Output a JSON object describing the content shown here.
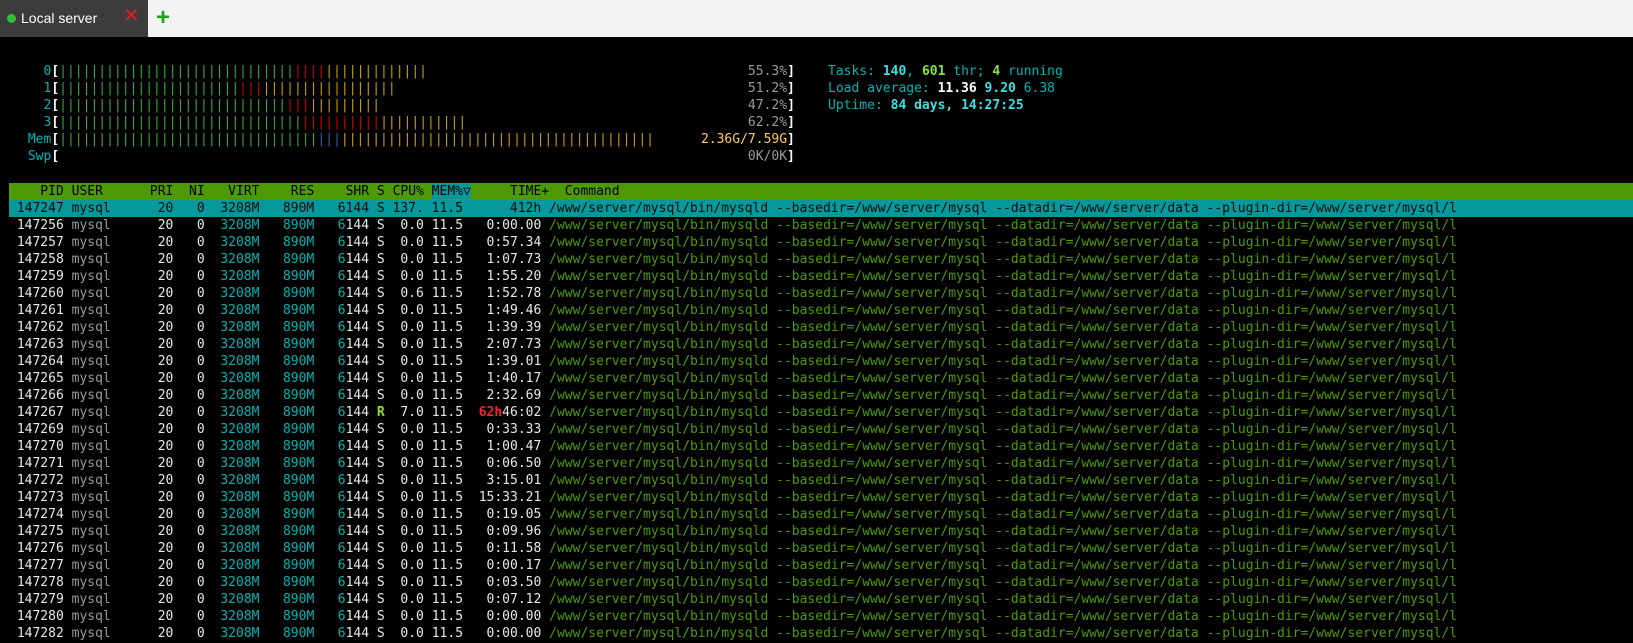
{
  "tabs": [
    {
      "label": "Local server",
      "status_color": "#2fbf2f"
    }
  ],
  "add_tab_icon": "plus-icon",
  "close_tab_icon": "close-x-icon",
  "meters": {
    "cpus": [
      {
        "id": "0",
        "green": 30,
        "red": 4,
        "yellow": 13,
        "percent": "55.3%"
      },
      {
        "id": "1",
        "green": 23,
        "red": 3,
        "yellow": 17,
        "percent": "51.2%"
      },
      {
        "id": "2",
        "green": 29,
        "red": 3,
        "yellow": 9,
        "percent": "47.2%"
      },
      {
        "id": "3",
        "green": 31,
        "red": 10,
        "yellow": 11,
        "percent": "62.2%"
      }
    ],
    "mem": {
      "label": "Mem",
      "green": 33,
      "blue": 3,
      "yellow": 40,
      "value": "2.36G/7.59G"
    },
    "swp": {
      "label": "Swp",
      "value": "0K/0K"
    }
  },
  "sysinfo": {
    "tasks_label": "Tasks:",
    "tasks": "140",
    "threads": "601",
    "thr_label": "thr;",
    "running": "4",
    "running_label": "running",
    "load_label": "Load average:",
    "load1": "11.36",
    "load5": "9.20",
    "load15": "6.38",
    "uptime_label": "Uptime:",
    "uptime": "84 days, 14:27:25"
  },
  "columns": [
    "PID",
    "USER",
    "PRI",
    "NI",
    "VIRT",
    "RES",
    "SHR",
    "S",
    "CPU%",
    "MEM%",
    "TIME+",
    "Command"
  ],
  "sort_column": "MEM%",
  "selected_process": {
    "pid": "147247",
    "user": "mysql",
    "pri": "20",
    "ni": "0",
    "virt": "3208M",
    "res": "890M",
    "shr": "6144",
    "state": "S",
    "cpu": "137.",
    "mem": "11.5",
    "time": "412h",
    "command": "/www/server/mysql/bin/mysqld --basedir=/www/server/mysql --datadir=/www/server/data --plugin-dir=/www/server/mysql/l"
  },
  "processes": [
    {
      "pid": "147256",
      "state": "S",
      "cpu": "0.0",
      "time_h": "",
      "time": "0:00.00"
    },
    {
      "pid": "147257",
      "state": "S",
      "cpu": "0.0",
      "time_h": "",
      "time": "0:57.34"
    },
    {
      "pid": "147258",
      "state": "S",
      "cpu": "0.0",
      "time_h": "",
      "time": "1:07.73"
    },
    {
      "pid": "147259",
      "state": "S",
      "cpu": "0.0",
      "time_h": "",
      "time": "1:55.20"
    },
    {
      "pid": "147260",
      "state": "S",
      "cpu": "0.6",
      "time_h": "",
      "time": "1:52.78"
    },
    {
      "pid": "147261",
      "state": "S",
      "cpu": "0.0",
      "time_h": "",
      "time": "1:49.46"
    },
    {
      "pid": "147262",
      "state": "S",
      "cpu": "0.0",
      "time_h": "",
      "time": "1:39.39"
    },
    {
      "pid": "147263",
      "state": "S",
      "cpu": "0.0",
      "time_h": "",
      "time": "2:07.73"
    },
    {
      "pid": "147264",
      "state": "S",
      "cpu": "0.0",
      "time_h": "",
      "time": "1:39.01"
    },
    {
      "pid": "147265",
      "state": "S",
      "cpu": "0.0",
      "time_h": "",
      "time": "1:40.17"
    },
    {
      "pid": "147266",
      "state": "S",
      "cpu": "0.0",
      "time_h": "",
      "time": "2:32.69"
    },
    {
      "pid": "147267",
      "state": "R",
      "cpu": "7.0",
      "time_h": "62h",
      "time": "46:02"
    },
    {
      "pid": "147269",
      "state": "S",
      "cpu": "0.0",
      "time_h": "",
      "time": "0:33.33"
    },
    {
      "pid": "147270",
      "state": "S",
      "cpu": "0.0",
      "time_h": "",
      "time": "1:00.47"
    },
    {
      "pid": "147271",
      "state": "S",
      "cpu": "0.0",
      "time_h": "",
      "time": "0:06.50"
    },
    {
      "pid": "147272",
      "state": "S",
      "cpu": "0.0",
      "time_h": "",
      "time": "3:15.01"
    },
    {
      "pid": "147273",
      "state": "S",
      "cpu": "0.0",
      "time_h": "",
      "time": "15:33.21"
    },
    {
      "pid": "147274",
      "state": "S",
      "cpu": "0.0",
      "time_h": "",
      "time": "0:19.05"
    },
    {
      "pid": "147275",
      "state": "S",
      "cpu": "0.0",
      "time_h": "",
      "time": "0:09.96"
    },
    {
      "pid": "147276",
      "state": "S",
      "cpu": "0.0",
      "time_h": "",
      "time": "0:11.58"
    },
    {
      "pid": "147277",
      "state": "S",
      "cpu": "0.0",
      "time_h": "",
      "time": "0:00.17"
    },
    {
      "pid": "147278",
      "state": "S",
      "cpu": "0.0",
      "time_h": "",
      "time": "0:03.50"
    },
    {
      "pid": "147279",
      "state": "S",
      "cpu": "0.0",
      "time_h": "",
      "time": "0:07.12"
    },
    {
      "pid": "147280",
      "state": "S",
      "cpu": "0.0",
      "time_h": "",
      "time": "0:00.00"
    },
    {
      "pid": "147282",
      "state": "S",
      "cpu": "0.0",
      "time_h": "",
      "time": "0:00.00"
    }
  ],
  "row_defaults": {
    "user": "mysql",
    "pri": "20",
    "ni": "0",
    "virt": "3208M",
    "res": "890M",
    "shr": "6144",
    "mem": "11.5",
    "command": "/www/server/mysql/bin/mysqld --basedir=/www/server/mysql --datadir=/www/server/data --plugin-dir=/www/server/mysql/l"
  }
}
